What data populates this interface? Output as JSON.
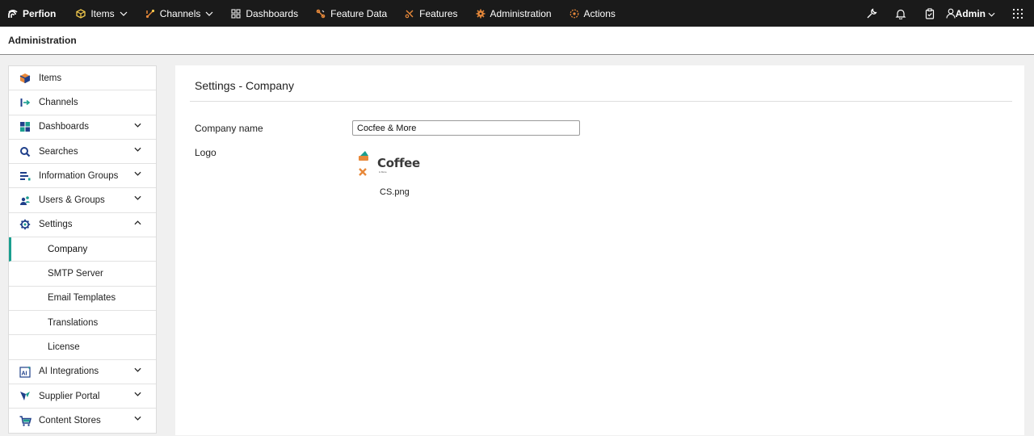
{
  "topnav": {
    "brand": "Perfion",
    "items": [
      {
        "label": "Items",
        "icon": "cube-icon"
      },
      {
        "label": "Channels",
        "icon": "channels-icon"
      },
      {
        "label": "Dashboards",
        "icon": "dashboard-icon"
      },
      {
        "label": "Feature Data",
        "icon": "feature-data-icon"
      },
      {
        "label": "Features",
        "icon": "features-icon"
      },
      {
        "label": "Administration",
        "icon": "gear-icon"
      },
      {
        "label": "Actions",
        "icon": "actions-icon"
      }
    ],
    "user": "Admin"
  },
  "subheader": {
    "title": "Administration"
  },
  "sidebar": {
    "items": [
      {
        "label": "Items",
        "icon": "cube-icon"
      },
      {
        "label": "Channels",
        "icon": "channels-icon"
      },
      {
        "label": "Dashboards",
        "icon": "dashboard-icon"
      },
      {
        "label": "Searches",
        "icon": "search-icon"
      },
      {
        "label": "Information Groups",
        "icon": "info-groups-icon"
      },
      {
        "label": "Users & Groups",
        "icon": "users-icon"
      },
      {
        "label": "Settings",
        "icon": "settings-icon"
      },
      {
        "label": "Company"
      },
      {
        "label": "SMTP Server"
      },
      {
        "label": "Email Templates"
      },
      {
        "label": "Translations"
      },
      {
        "label": "License"
      },
      {
        "label": "AI Integrations",
        "icon": "ai-icon"
      },
      {
        "label": "Supplier Portal",
        "icon": "supplier-icon"
      },
      {
        "label": "Content Stores",
        "icon": "cart-icon"
      }
    ]
  },
  "main": {
    "title": "Settings - Company",
    "company_name_label": "Company name",
    "company_name_value": "Cocfee & More",
    "logo_label": "Logo",
    "logo_text": "Coffee",
    "logo_subtext": "& More",
    "logo_filename": "CS.png"
  },
  "colors": {
    "topnav_bg": "#1a1a1a",
    "accent": "#1a9e8f",
    "icon_blue": "#1f3f8a",
    "icon_orange": "#e8893a"
  }
}
